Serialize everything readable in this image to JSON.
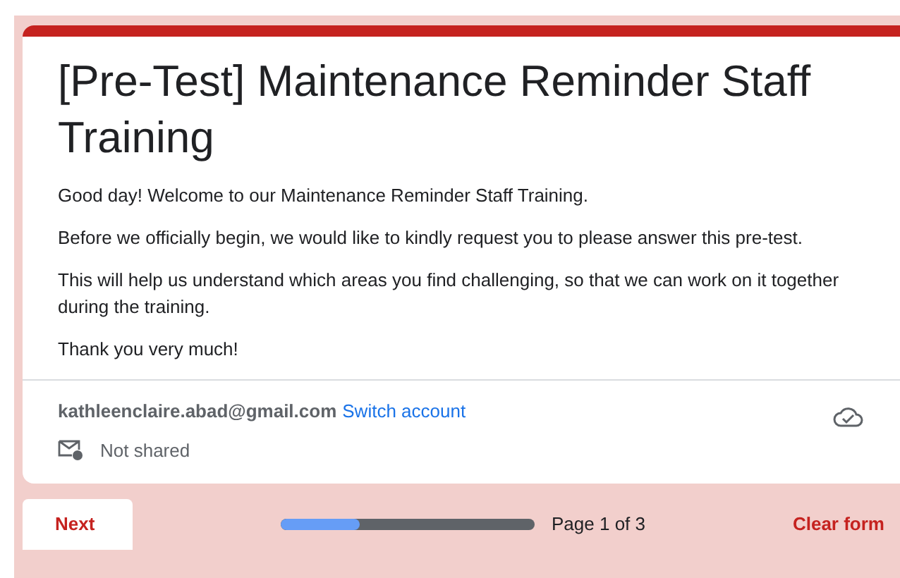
{
  "form": {
    "title": "[Pre-Test] Maintenance Reminder Staff Training",
    "paragraphs": [
      "Good day! Welcome to our Maintenance Reminder Staff Training.",
      "Before we officially begin, we would like to kindly request you to please answer this pre-test.",
      "This will help us understand which areas you find challenging, so that we can work on it together during the training.",
      "Thank you very much!"
    ]
  },
  "account": {
    "email": "kathleenclaire.abad@gmail.com",
    "switch_link": "Switch account",
    "sharing": "Not shared"
  },
  "footer": {
    "next_button": "Next",
    "progress": {
      "level": 0.31
    },
    "page_label": "Page 1 of 3",
    "clear_button": "Clear form"
  }
}
